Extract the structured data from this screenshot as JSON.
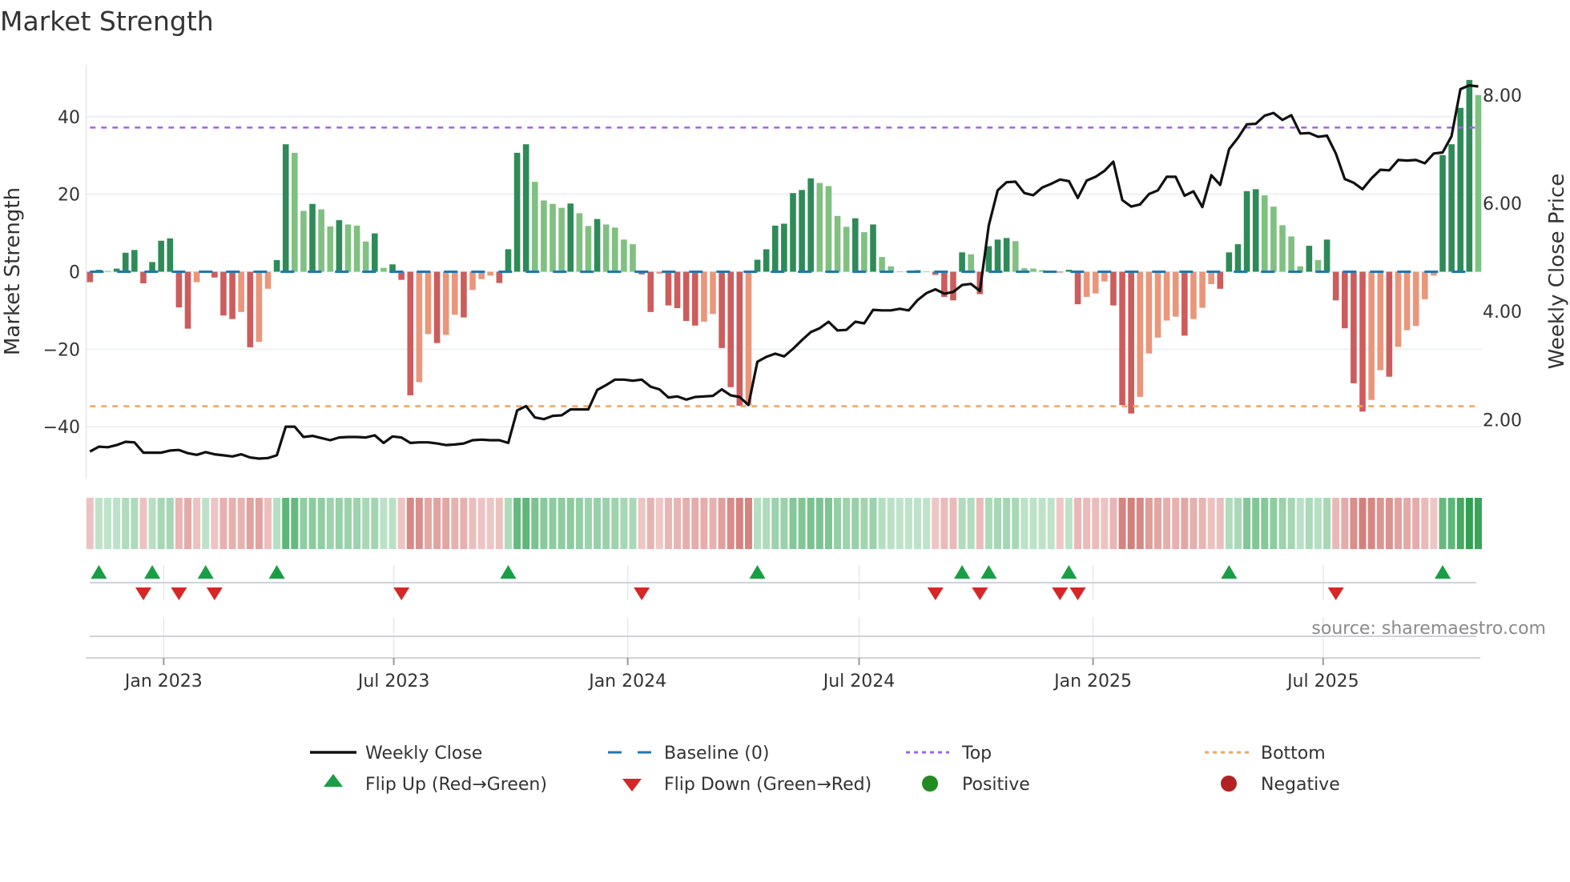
{
  "title": "Market Strength",
  "source": "source: sharemaestro.com",
  "colors": {
    "bar_pos_rising": "#2e8b57",
    "bar_pos_falling": "#80c080",
    "bar_neg_falling": "#cd5c5c",
    "bar_neg_rising": "#e9967a",
    "weekly_close": "#111111",
    "baseline": "#1f77b4",
    "top": "#a066e0",
    "bottom": "#f4a460",
    "flip_up": "#1a9e45",
    "flip_down": "#d62728",
    "positive": "#228b22",
    "negative": "#b22222",
    "grid": "#eef0f3"
  },
  "chart_data": {
    "type": "bar",
    "title": "Market Strength",
    "ylabel": "Market Strength",
    "y2label": "Weekly Close Price",
    "ylim": [
      -53.4,
      53.4
    ],
    "y2lim": [
      0.91,
      8.56
    ],
    "grid": true,
    "start_date": "2022-11-04",
    "frequency": "weekly",
    "y_ticks": [
      {
        "v": 40,
        "label": "40"
      },
      {
        "v": 20,
        "label": "20"
      },
      {
        "v": 0,
        "label": "0"
      },
      {
        "v": -20,
        "label": "−20"
      },
      {
        "v": -40,
        "label": "−40"
      }
    ],
    "y2_ticks": [
      {
        "v": 8,
        "label": "8.00"
      },
      {
        "v": 6,
        "label": "6.00"
      },
      {
        "v": 4,
        "label": "4.00"
      },
      {
        "v": 2,
        "label": "2.00"
      }
    ],
    "x_ticks": [
      {
        "date": "2023-01-01",
        "label": "Jan 2023"
      },
      {
        "date": "2023-07-01",
        "label": "Jul 2023"
      },
      {
        "date": "2024-01-01",
        "label": "Jan 2024"
      },
      {
        "date": "2024-07-01",
        "label": "Jul 2024"
      },
      {
        "date": "2025-01-01",
        "label": "Jan 2025"
      },
      {
        "date": "2025-07-01",
        "label": "Jul 2025"
      }
    ],
    "top_level": 37.2,
    "bottom_level": -34.7,
    "baseline": 0,
    "series": [
      {
        "name": "Market Strength",
        "axis": "left",
        "values": [
          -2.7,
          0.5,
          0.2,
          0.8,
          4.9,
          5.6,
          -3.0,
          2.5,
          8.0,
          8.6,
          -9.2,
          -14.7,
          -2.7,
          0.3,
          -1.5,
          -11.3,
          -12.2,
          -10.4,
          -19.5,
          -18.1,
          -4.4,
          3.0,
          32.9,
          30.7,
          15.7,
          17.5,
          16.1,
          11.7,
          13.3,
          12.2,
          11.9,
          7.8,
          9.9,
          1.0,
          1.9,
          -2.1,
          -31.9,
          -28.5,
          -16.1,
          -18.4,
          -16.3,
          -11.1,
          -11.8,
          -4.7,
          -1.9,
          -1.0,
          -2.9,
          5.8,
          30.7,
          32.9,
          23.2,
          18.4,
          17.5,
          16.5,
          17.6,
          15.1,
          11.8,
          13.6,
          12.2,
          11.4,
          8.3,
          7.1,
          -0.7,
          -10.4,
          -0.5,
          -8.7,
          -9.4,
          -12.7,
          -13.9,
          -12.9,
          -10.9,
          -19.7,
          -29.8,
          -34.6,
          -34.5,
          3.1,
          5.8,
          11.9,
          12.4,
          20.3,
          21.1,
          24.1,
          22.9,
          22.1,
          14.4,
          11.6,
          13.8,
          10.2,
          12.2,
          3.8,
          1.4,
          0.1,
          0.1,
          0.4,
          0.1,
          -0.8,
          -6.5,
          -7.4,
          5.0,
          4.5,
          -5.8,
          6.6,
          8.3,
          8.7,
          7.9,
          0.9,
          0.8,
          0.4,
          0.2,
          -0.2,
          0.5,
          -8.4,
          -6.5,
          -5.6,
          -2.5,
          -8.7,
          -34.4,
          -36.6,
          -32.3,
          -21.1,
          -17.0,
          -12.6,
          -11.6,
          -16.5,
          -12.2,
          -9.3,
          -3.2,
          -4.4,
          5.0,
          7.1,
          20.8,
          21.3,
          19.7,
          16.8,
          12.0,
          9.1,
          1.4,
          6.7,
          3.0,
          8.3,
          -7.4,
          -14.6,
          -28.8,
          -36.1,
          -33.1,
          -25.4,
          -27.1,
          -19.4,
          -15.1,
          -14.0,
          -7.1,
          -1.0,
          30.1,
          32.9,
          42.3,
          49.5,
          45.6
        ]
      },
      {
        "name": "Weekly Close",
        "axis": "right",
        "type": "line",
        "values": [
          1.41,
          1.5,
          1.49,
          1.53,
          1.59,
          1.58,
          1.39,
          1.39,
          1.39,
          1.43,
          1.44,
          1.38,
          1.35,
          1.4,
          1.36,
          1.34,
          1.32,
          1.36,
          1.3,
          1.28,
          1.29,
          1.34,
          1.87,
          1.87,
          1.68,
          1.7,
          1.66,
          1.62,
          1.67,
          1.68,
          1.68,
          1.67,
          1.71,
          1.57,
          1.69,
          1.67,
          1.57,
          1.58,
          1.58,
          1.56,
          1.53,
          1.54,
          1.56,
          1.62,
          1.63,
          1.62,
          1.62,
          1.57,
          2.17,
          2.25,
          2.04,
          2.01,
          2.07,
          2.08,
          2.19,
          2.19,
          2.19,
          2.55,
          2.64,
          2.74,
          2.74,
          2.72,
          2.74,
          2.61,
          2.56,
          2.41,
          2.43,
          2.37,
          2.42,
          2.43,
          2.44,
          2.56,
          2.45,
          2.42,
          2.27,
          3.07,
          3.16,
          3.22,
          3.17,
          3.31,
          3.47,
          3.62,
          3.69,
          3.81,
          3.65,
          3.66,
          3.81,
          3.78,
          4.03,
          4.02,
          4.02,
          4.05,
          4.02,
          4.21,
          4.34,
          4.41,
          4.33,
          4.36,
          4.49,
          4.51,
          4.38,
          5.59,
          6.24,
          6.39,
          6.4,
          6.19,
          6.15,
          6.29,
          6.36,
          6.44,
          6.41,
          6.1,
          6.42,
          6.49,
          6.6,
          6.77,
          6.06,
          5.94,
          5.98,
          6.17,
          6.24,
          6.49,
          6.49,
          6.14,
          6.22,
          5.93,
          6.52,
          6.34,
          7.0,
          7.21,
          7.46,
          7.47,
          7.62,
          7.67,
          7.54,
          7.63,
          7.29,
          7.3,
          7.23,
          7.25,
          6.92,
          6.45,
          6.38,
          6.26,
          6.46,
          6.62,
          6.61,
          6.8,
          6.79,
          6.8,
          6.74,
          6.92,
          6.94,
          7.24,
          8.11,
          8.18,
          8.16
        ]
      }
    ],
    "legend": {
      "placement": "bottom-center",
      "items": [
        {
          "label": "Weekly Close",
          "symbol": "line"
        },
        {
          "label": "Baseline (0)",
          "symbol": "dashed-line"
        },
        {
          "label": "Top",
          "symbol": "dotted-line"
        },
        {
          "label": "Bottom",
          "symbol": "dotted-line"
        },
        {
          "label": "Flip Up (Red→Green)",
          "symbol": "triangle-up"
        },
        {
          "label": "Flip Down (Green→Red)",
          "symbol": "triangle-down"
        },
        {
          "label": "Positive",
          "symbol": "circle"
        },
        {
          "label": "Negative",
          "symbol": "circle"
        }
      ]
    }
  }
}
